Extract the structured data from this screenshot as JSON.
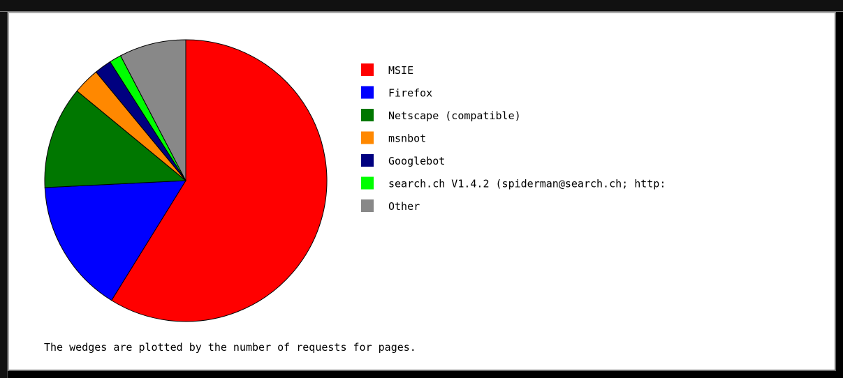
{
  "chart_data": {
    "type": "pie",
    "slices": [
      {
        "label": "MSIE",
        "value": 60.0,
        "color": "#ff0000"
      },
      {
        "label": "Firefox",
        "value": 15.7,
        "color": "#0000ff"
      },
      {
        "label": "Netscape (compatible)",
        "value": 12.0,
        "color": "#007700"
      },
      {
        "label": "msnbot",
        "value": 3.1,
        "color": "#ff8800"
      },
      {
        "label": "Googlebot",
        "value": 2.0,
        "color": "#000080"
      },
      {
        "label": "search.ch V1.4.2 (spiderman@search.ch; http:",
        "value": 1.4,
        "color": "#00ff00"
      },
      {
        "label": "Other",
        "value": 7.8,
        "color": "#888888"
      }
    ],
    "legend_position": "right",
    "caption": "The wedges are plotted by the number of requests for pages."
  }
}
